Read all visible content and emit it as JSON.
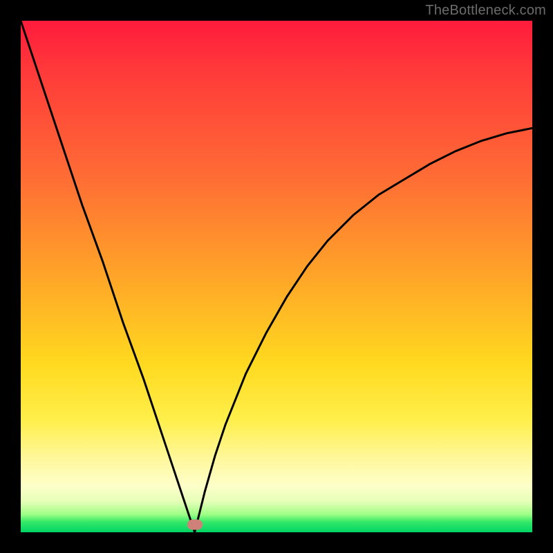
{
  "watermark": "TheBottleneck.com",
  "colors": {
    "background": "#000000",
    "gradient_top": "#ff1b3c",
    "gradient_mid": "#ffd91f",
    "gradient_bottom": "#00d565",
    "curve": "#000000",
    "marker": "#cf8078",
    "watermark_text": "#6c6c6c"
  },
  "chart_data": {
    "type": "line",
    "title": "",
    "xlabel": "",
    "ylabel": "",
    "xlim": [
      0,
      100
    ],
    "ylim": [
      0,
      100
    ],
    "grid": false,
    "legend": false,
    "annotations": [
      {
        "kind": "marker",
        "x": 34,
        "y": 1.5,
        "shape": "pill",
        "color": "#cf8078"
      }
    ],
    "series": [
      {
        "name": "left-branch",
        "x": [
          0,
          4,
          8,
          12,
          16,
          20,
          24,
          28,
          30,
          32,
          33,
          34
        ],
        "y": [
          100,
          88,
          76,
          64,
          53,
          41,
          30,
          18,
          12,
          6,
          3,
          0
        ]
      },
      {
        "name": "right-branch",
        "x": [
          34,
          36,
          38,
          40,
          44,
          48,
          52,
          56,
          60,
          65,
          70,
          75,
          80,
          85,
          90,
          95,
          100
        ],
        "y": [
          0,
          8,
          15,
          21,
          31,
          39,
          46,
          52,
          57,
          62,
          66,
          69,
          72,
          74.5,
          76.5,
          78,
          79
        ]
      }
    ]
  }
}
